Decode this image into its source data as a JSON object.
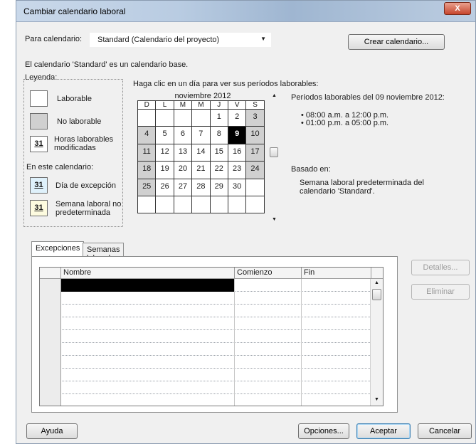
{
  "window": {
    "title": "Cambiar calendario laboral",
    "close": "X"
  },
  "top": {
    "for_calendar_label": "Para calendario:",
    "calendar_value": "Standard (Calendario del proyecto)",
    "create_button": "Crear calendario...",
    "base_note": "El calendario 'Standard' es un calendario base."
  },
  "legend": {
    "title": "Leyenda:",
    "working": "Laborable",
    "nonworking": "No laborable",
    "modified_line1": "Horas laborables",
    "modified_line2": "modificadas",
    "modified_num": "31",
    "in_this_calendar": "En este calendario:",
    "exception": "Día de excepción",
    "exception_num": "31",
    "nondefault_line1": "Semana laboral no",
    "nondefault_line2": "predeterminada",
    "nondefault_num": "31"
  },
  "calendar": {
    "instruction": "Haga clic en un día para ver sus períodos laborables:",
    "month": "noviembre 2012",
    "days": [
      "D",
      "L",
      "M",
      "M",
      "J",
      "V",
      "S"
    ],
    "weeks": [
      [
        "",
        "",
        "",
        "",
        "1",
        "2",
        "3"
      ],
      [
        "4",
        "5",
        "6",
        "7",
        "8",
        "9",
        "10"
      ],
      [
        "11",
        "12",
        "13",
        "14",
        "15",
        "16",
        "17"
      ],
      [
        "18",
        "19",
        "20",
        "21",
        "22",
        "23",
        "24"
      ],
      [
        "25",
        "26",
        "27",
        "28",
        "29",
        "30",
        ""
      ],
      [
        "",
        "",
        "",
        "",
        "",
        "",
        ""
      ]
    ],
    "selected_day": "9"
  },
  "periods": {
    "heading": "Períodos laborables del 09 noviembre 2012:",
    "items": [
      "• 08:00 a.m. a 12:00 p.m.",
      "• 01:00 p.m. a 05:00 p.m."
    ],
    "based_on_label": "Basado en:",
    "based_on_line1": "Semana laboral predeterminada del",
    "based_on_line2": "calendario 'Standard'."
  },
  "tabs": [
    "Excepciones",
    "Semanas laborales"
  ],
  "grid": {
    "columns": [
      "Nombre",
      "Comienzo",
      "Fin"
    ]
  },
  "side_buttons": {
    "details": "Detalles...",
    "delete": "Eliminar"
  },
  "footer": {
    "help": "Ayuda",
    "options": "Opciones...",
    "ok": "Aceptar",
    "cancel": "Cancelar"
  },
  "colors": {
    "selected_day": "#000000",
    "nonworking": "#d0d0d0",
    "title_bar": "#b9cce2"
  }
}
